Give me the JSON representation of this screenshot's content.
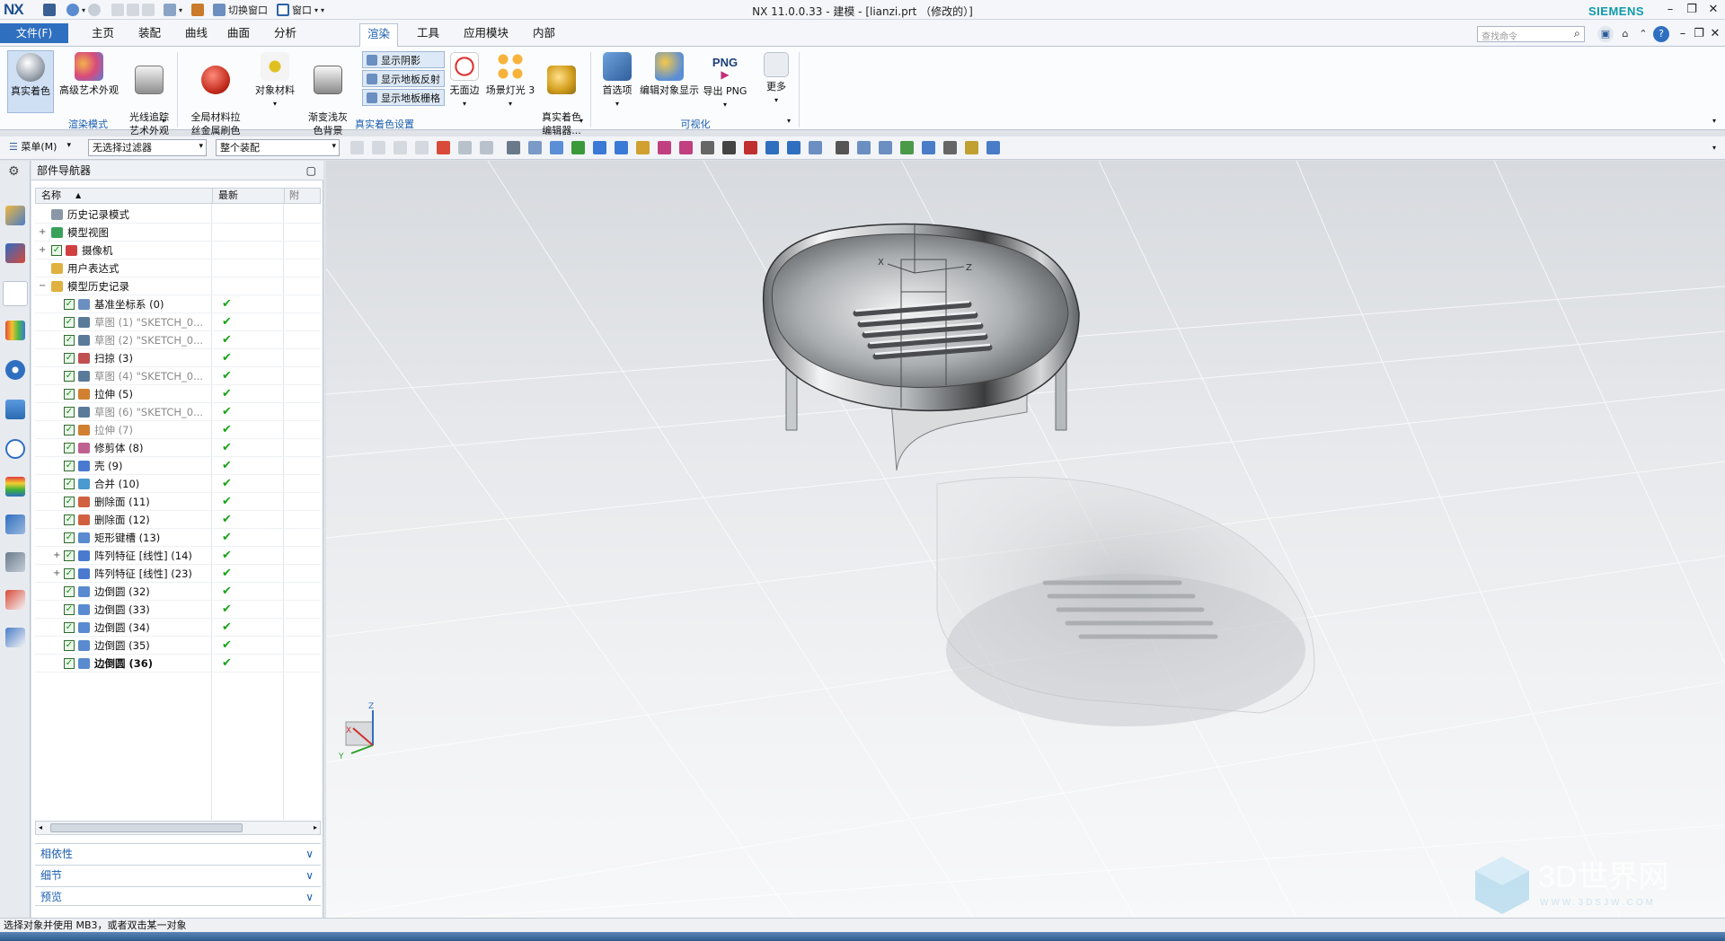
{
  "titlebar": {
    "logo": "NX",
    "title": "NX 11.0.0.33 - 建模 - [lianzi.prt （修改的）]",
    "brand": "SIEMENS",
    "switch_window": "切换窗口",
    "window_menu": "窗口"
  },
  "menu": {
    "file": "文件(F)",
    "tabs": [
      "主页",
      "装配",
      "曲线",
      "曲面",
      "分析",
      "渲染",
      "工具",
      "应用模块",
      "内部"
    ],
    "active_tab": "渲染",
    "search_placeholder": "查找命令"
  },
  "ribbon": {
    "groups": [
      {
        "label": "渲染模式",
        "buttons": [
          "真实着色",
          "高级艺术外观",
          "光线追踪\n艺术外观"
        ]
      },
      {
        "label": "真实着色设置",
        "buttons": [
          "全局材料拉\n丝金属刷色",
          "对象材料",
          "渐变浅灰\n色背景",
          "无面边",
          "场景灯光 3",
          "真实着色\n编辑器..."
        ],
        "toggles": [
          "显示阴影",
          "显示地板反射",
          "显示地板栅格"
        ]
      },
      {
        "label": "可视化",
        "buttons": [
          "首选项",
          "编辑对象显示",
          "导出 PNG",
          "更多"
        ]
      }
    ],
    "png_text": "PNG"
  },
  "cmdbar": {
    "menu": "菜单(M)",
    "filter": "无选择过滤器",
    "scope": "整个装配"
  },
  "navigator": {
    "title": "部件导航器",
    "columns": [
      "名称",
      "最新",
      "附"
    ],
    "tree": [
      {
        "label": "历史记录模式",
        "level": 0,
        "icon": "history-icon"
      },
      {
        "label": "模型视图",
        "level": 0,
        "icon": "views-icon",
        "expand": "+"
      },
      {
        "label": "摄像机",
        "level": 0,
        "icon": "camera-icon",
        "expand": "+",
        "check": true
      },
      {
        "label": "用户表达式",
        "level": 0,
        "icon": "folder-icon"
      },
      {
        "label": "模型历史记录",
        "level": 0,
        "icon": "folder-icon",
        "expand": "−"
      }
    ],
    "features": [
      {
        "label": "基准坐标系 (0)",
        "dim": false
      },
      {
        "label": "草图 (1) \"SKETCH_0...",
        "dim": true
      },
      {
        "label": "草图 (2) \"SKETCH_0...",
        "dim": true
      },
      {
        "label": "扫掠 (3)",
        "dim": false
      },
      {
        "label": "草图 (4) \"SKETCH_0...",
        "dim": true
      },
      {
        "label": "拉伸 (5)",
        "dim": false
      },
      {
        "label": "草图 (6) \"SKETCH_0...",
        "dim": true
      },
      {
        "label": "拉伸 (7)",
        "dim": true
      },
      {
        "label": "修剪体 (8)",
        "dim": false
      },
      {
        "label": "壳 (9)",
        "dim": false
      },
      {
        "label": "合并 (10)",
        "dim": false
      },
      {
        "label": "删除面 (11)",
        "dim": false
      },
      {
        "label": "删除面 (12)",
        "dim": false
      },
      {
        "label": "矩形键槽 (13)",
        "dim": false
      },
      {
        "label": "阵列特征 [线性] (14)",
        "dim": false,
        "expand": true
      },
      {
        "label": "阵列特征 [线性] (23)",
        "dim": false,
        "expand": true
      },
      {
        "label": "边倒圆 (32)",
        "dim": false
      },
      {
        "label": "边倒圆 (33)",
        "dim": false
      },
      {
        "label": "边倒圆 (34)",
        "dim": false
      },
      {
        "label": "边倒圆 (35)",
        "dim": false
      },
      {
        "label": "边倒圆 (36)",
        "dim": false,
        "bold": true
      }
    ],
    "panels": [
      "相依性",
      "细节",
      "预览"
    ]
  },
  "viewport": {
    "axis_x": "X",
    "axis_y": "Y",
    "axis_z": "Z",
    "triad_x": "X",
    "triad_y": "Y",
    "triad_z": "Z"
  },
  "status": {
    "message": "选择对象并使用 MB3，或者双击某一对象"
  },
  "watermark": {
    "text": "3D世界网",
    "url": "WWW.3DSJW.COM"
  },
  "colors": {
    "accent": "#2f6fc0",
    "check": "#1aa31a",
    "brand": "#0f9aa8"
  }
}
